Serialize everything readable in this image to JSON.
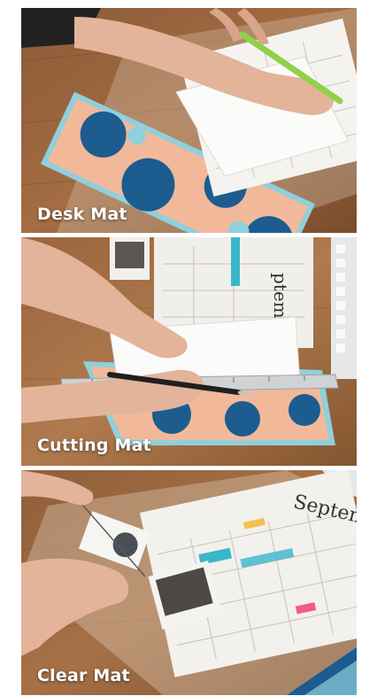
{
  "panels": [
    {
      "caption": "Desk Mat"
    },
    {
      "caption": "Cutting Mat"
    },
    {
      "caption": "Clear Mat"
    }
  ],
  "calendar_month": "September",
  "calendar_month_partial": "ptember"
}
